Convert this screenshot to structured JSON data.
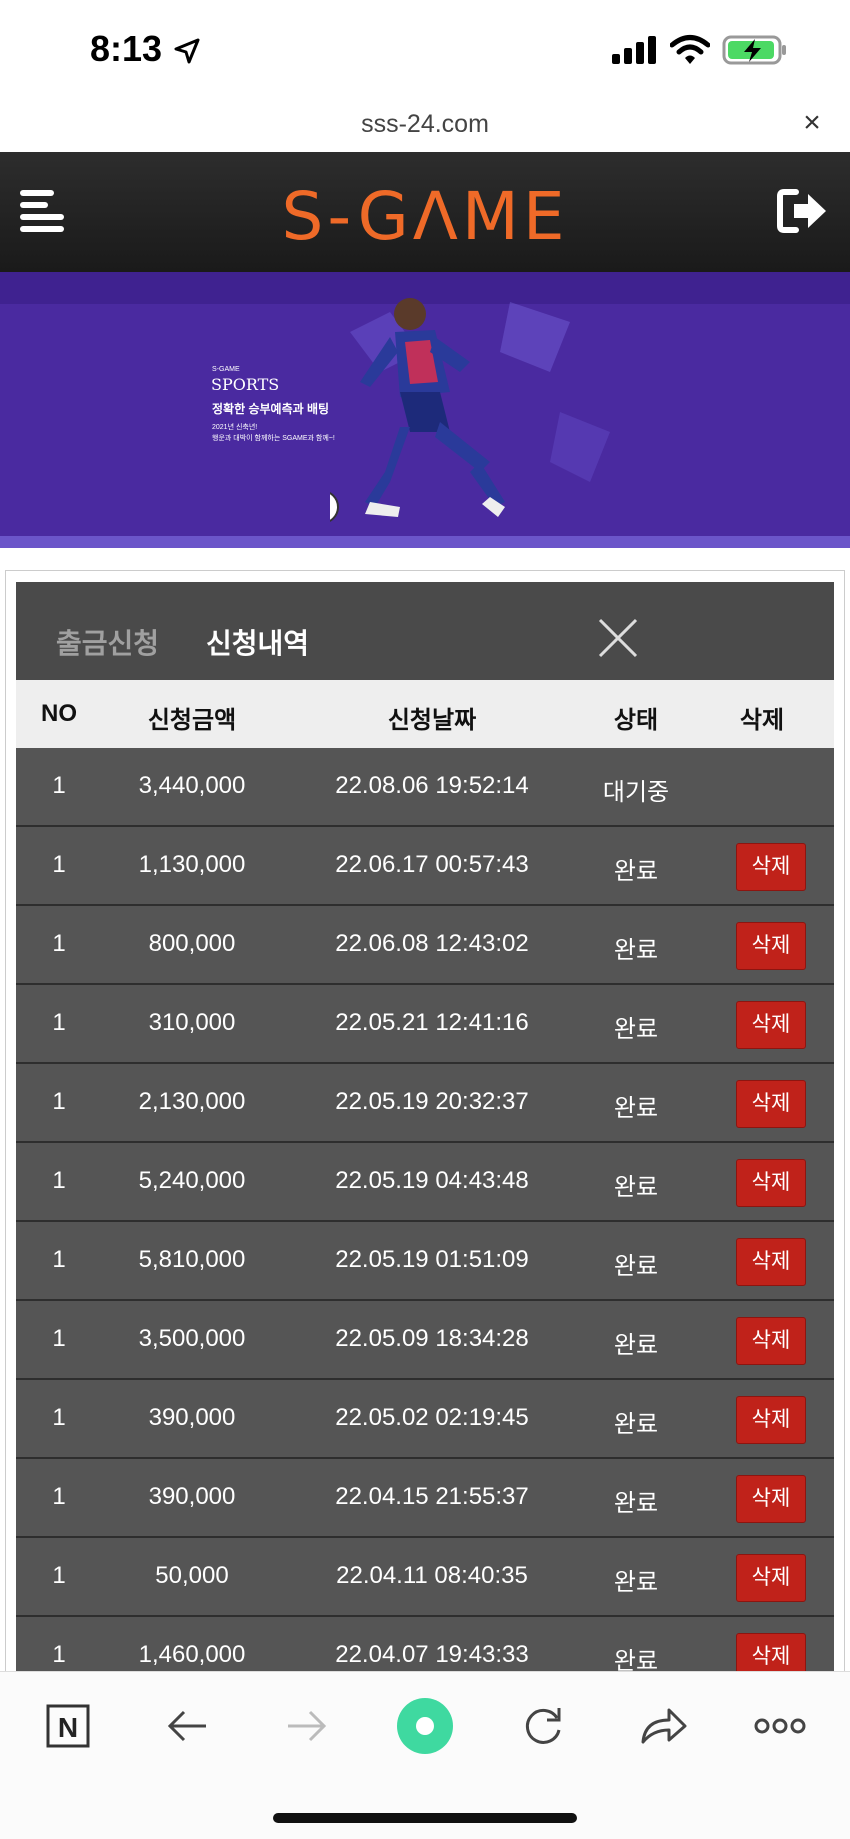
{
  "status_bar": {
    "time": "8:13"
  },
  "browser": {
    "url": "sss-24.com",
    "close": "×"
  },
  "header": {
    "logo": "S-GΛME"
  },
  "banner": {
    "small_brand": "S-GAME",
    "sports": "SPORTS",
    "slogan": "정확한 승부예측과 배팅",
    "sub1": "2021년 신축년!",
    "sub2": "행운과 대박이 함께하는 SGAME과 함께~!"
  },
  "panel": {
    "tabs": [
      "출금신청",
      "신청내역"
    ],
    "active_tab": "신청내역",
    "columns": [
      "NO",
      "신청금액",
      "신청날짜",
      "상태",
      "삭제"
    ],
    "delete_label": "삭제",
    "rows": [
      {
        "no": "1",
        "amount": "3,440,000",
        "date": "22.08.06 19:52:14",
        "status": "대기중",
        "deletable": false
      },
      {
        "no": "1",
        "amount": "1,130,000",
        "date": "22.06.17 00:57:43",
        "status": "완료",
        "deletable": true
      },
      {
        "no": "1",
        "amount": "800,000",
        "date": "22.06.08 12:43:02",
        "status": "완료",
        "deletable": true
      },
      {
        "no": "1",
        "amount": "310,000",
        "date": "22.05.21 12:41:16",
        "status": "완료",
        "deletable": true
      },
      {
        "no": "1",
        "amount": "2,130,000",
        "date": "22.05.19 20:32:37",
        "status": "완료",
        "deletable": true
      },
      {
        "no": "1",
        "amount": "5,240,000",
        "date": "22.05.19 04:43:48",
        "status": "완료",
        "deletable": true
      },
      {
        "no": "1",
        "amount": "5,810,000",
        "date": "22.05.19 01:51:09",
        "status": "완료",
        "deletable": true
      },
      {
        "no": "1",
        "amount": "3,500,000",
        "date": "22.05.09 18:34:28",
        "status": "완료",
        "deletable": true
      },
      {
        "no": "1",
        "amount": "390,000",
        "date": "22.05.02 02:19:45",
        "status": "완료",
        "deletable": true
      },
      {
        "no": "1",
        "amount": "390,000",
        "date": "22.04.15 21:55:37",
        "status": "완료",
        "deletable": true
      },
      {
        "no": "1",
        "amount": "50,000",
        "date": "22.04.11 08:40:35",
        "status": "완료",
        "deletable": true
      },
      {
        "no": "1",
        "amount": "1,460,000",
        "date": "22.04.07 19:43:33",
        "status": "완료",
        "deletable": true
      }
    ]
  },
  "toolbar": {
    "items": [
      "naver-n-icon",
      "back-arrow-icon",
      "forward-arrow-icon",
      "green-dot-icon",
      "reload-icon",
      "share-icon",
      "more-icon"
    ],
    "naver_label": "N",
    "more_label": "ooo"
  },
  "colors": {
    "accent": "#ef6a28",
    "banner": "#4a2aa0",
    "delete": "#c0221a",
    "panel": "#555555"
  }
}
